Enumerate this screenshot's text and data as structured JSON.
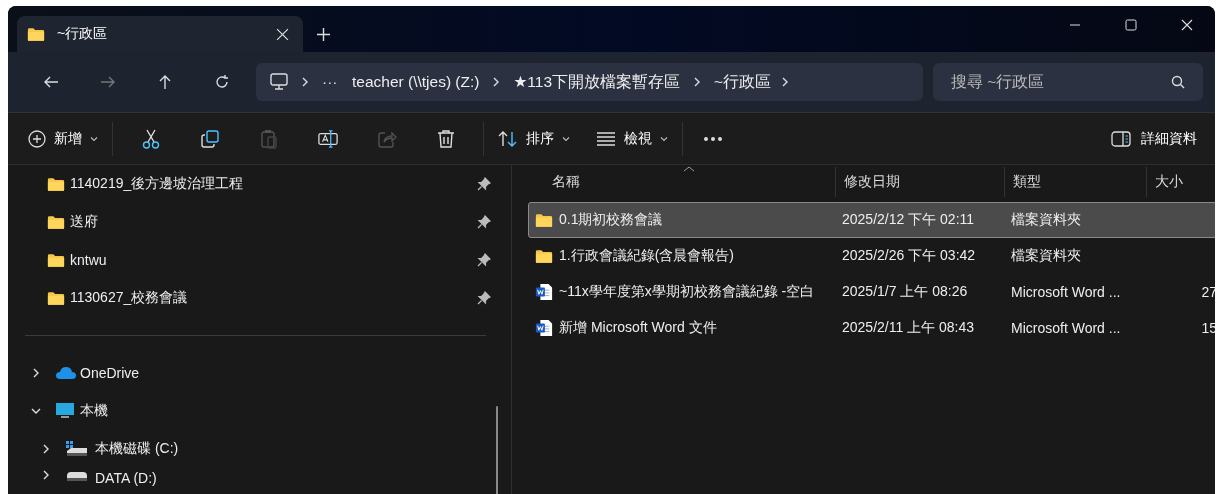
{
  "tab": {
    "title": "~行政區",
    "selected": true
  },
  "address": {
    "more": "···",
    "crumbs": [
      "teacher (\\\\tjes) (Z:)",
      "★113下開放檔案暫存區",
      "~行政區"
    ],
    "search_placeholder": "搜尋 ~行政區"
  },
  "toolbar": {
    "new_label": "新增",
    "actions": [
      {
        "kind": "cut",
        "disabled": false
      },
      {
        "kind": "copy",
        "disabled": false
      },
      {
        "kind": "paste",
        "disabled": true
      },
      {
        "kind": "rename",
        "disabled": false
      },
      {
        "kind": "share",
        "disabled": true
      },
      {
        "kind": "delete",
        "disabled": false
      }
    ],
    "sort_label": "排序",
    "view_label": "檢視",
    "details_label": "詳細資料"
  },
  "sidebar": {
    "pinned": [
      {
        "label": "1140219_後方邊坡治理工程",
        "pinned": true
      },
      {
        "label": "送府",
        "pinned": true
      },
      {
        "label": "kntwu",
        "pinned": true
      },
      {
        "label": "1130627_校務會議",
        "pinned": true
      }
    ],
    "tree": [
      {
        "label": "OneDrive",
        "kind": "cloud",
        "expanded": false
      },
      {
        "label": "本機",
        "kind": "pc",
        "expanded": true,
        "children": [
          {
            "label": "本機磁碟 (C:)",
            "kind": "system-drive",
            "expanded": false
          },
          {
            "label": "DATA (D:)",
            "kind": "drive",
            "expanded": false
          }
        ]
      }
    ]
  },
  "table": {
    "columns": [
      {
        "label": "名稱",
        "sorted": true
      },
      {
        "label": "修改日期",
        "sorted": false
      },
      {
        "label": "類型",
        "sorted": false
      },
      {
        "label": "大小",
        "sorted": false
      }
    ],
    "rows": [
      {
        "kind": "folder",
        "name": "0.1期初校務會議",
        "date": "2025/2/12 下午 02:11",
        "type": "檔案資料夾",
        "size": "",
        "selected": true
      },
      {
        "kind": "folder",
        "name": "1.行政會議紀錄(含晨會報告)",
        "date": "2025/2/26 下午 03:42",
        "type": "檔案資料夾",
        "size": "",
        "selected": false
      },
      {
        "kind": "word",
        "name": "~11x學年度第x學期初校務會議紀錄 -空白",
        "date": "2025/1/7 上午 08:26",
        "type": "Microsoft Word ...",
        "size": "27",
        "selected": false
      },
      {
        "kind": "word",
        "name": "新增 Microsoft Word 文件",
        "date": "2025/2/11 上午 08:43",
        "type": "Microsoft Word ...",
        "size": "15",
        "selected": false
      }
    ]
  }
}
